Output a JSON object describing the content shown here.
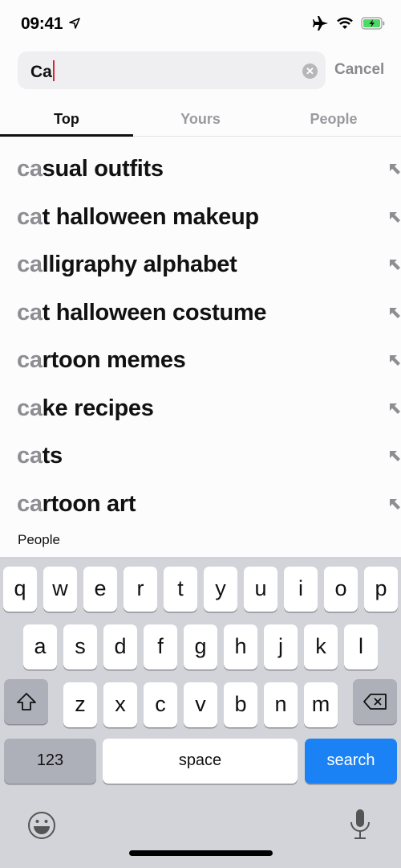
{
  "status_bar": {
    "time": "09:41",
    "icons": [
      "location-arrow-icon",
      "airplane-icon",
      "wifi-icon",
      "battery-charging-icon"
    ]
  },
  "search": {
    "query": "Ca",
    "clear_icon": "clear-icon",
    "cancel_label": "Cancel"
  },
  "tabs": [
    {
      "label": "Top",
      "active": true
    },
    {
      "label": "Yours",
      "active": false
    },
    {
      "label": "People",
      "active": false
    }
  ],
  "suggestions": [
    {
      "prefix": "ca",
      "rest": "sual outfits"
    },
    {
      "prefix": "ca",
      "rest": "t halloween makeup"
    },
    {
      "prefix": "ca",
      "rest": "lligraphy alphabet"
    },
    {
      "prefix": "ca",
      "rest": "t halloween costume"
    },
    {
      "prefix": "ca",
      "rest": "rtoon memes"
    },
    {
      "prefix": "ca",
      "rest": "ke recipes"
    },
    {
      "prefix": "ca",
      "rest": "ts"
    },
    {
      "prefix": "ca",
      "rest": "rtoon art"
    }
  ],
  "people_header": "People",
  "keyboard": {
    "row1": [
      "q",
      "w",
      "e",
      "r",
      "t",
      "y",
      "u",
      "i",
      "o",
      "p"
    ],
    "row2": [
      "a",
      "s",
      "d",
      "f",
      "g",
      "h",
      "j",
      "k",
      "l"
    ],
    "row3": [
      "z",
      "x",
      "c",
      "v",
      "b",
      "n",
      "m"
    ],
    "numbers_label": "123",
    "space_label": "space",
    "search_label": "search",
    "accent_color": "#1a82f5"
  }
}
